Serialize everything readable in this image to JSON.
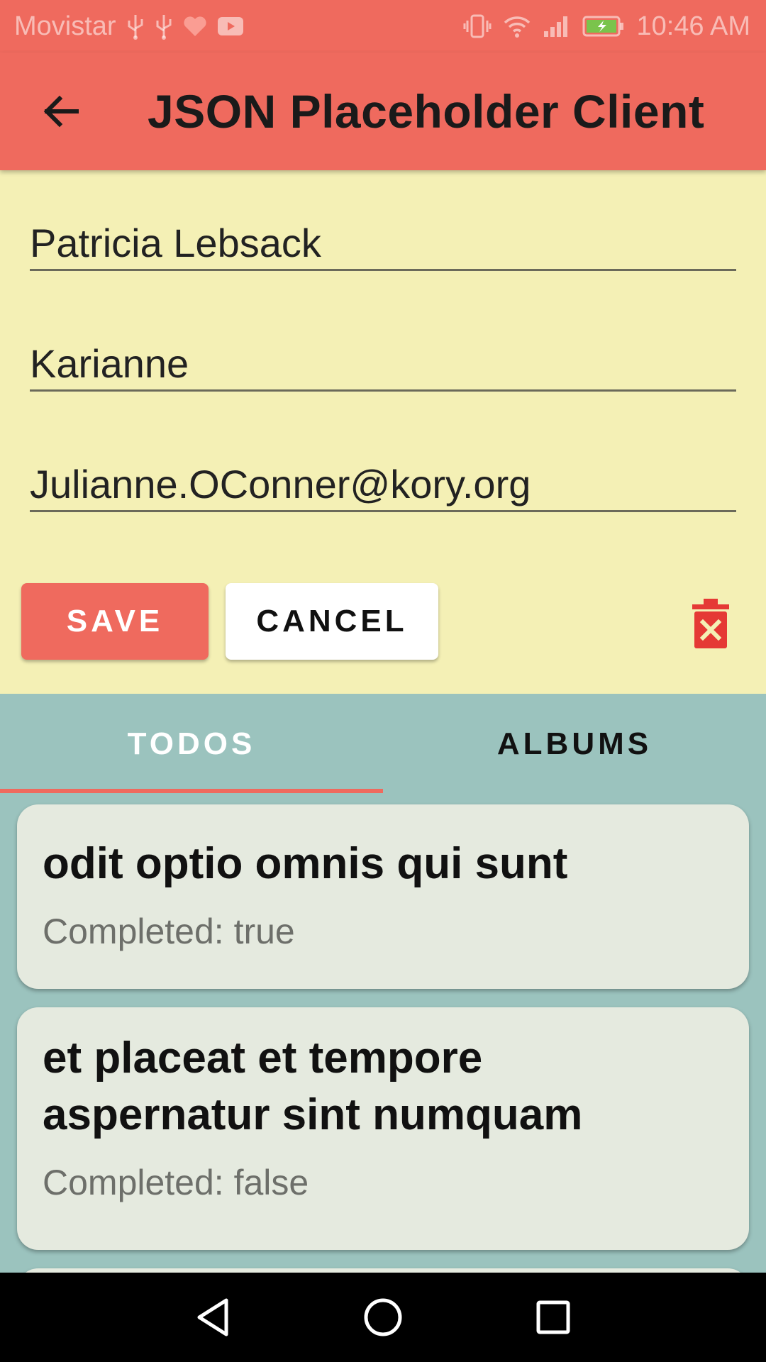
{
  "status_bar": {
    "carrier": "Movistar",
    "time": "10:46 AM",
    "icons": [
      "usb-icon",
      "usb-icon",
      "health-icon",
      "youtube-icon",
      "vibrate-icon",
      "wifi-icon",
      "signal-icon",
      "battery-charging-icon"
    ]
  },
  "app_bar": {
    "title": "JSON Placeholder Client",
    "back_icon": "arrow-back-icon"
  },
  "form": {
    "name": "Patricia Lebsack",
    "username": "Karianne",
    "email": "Julianne.OConner@kory.org",
    "save_label": "SAVE",
    "cancel_label": "CANCEL",
    "delete_icon": "trash-delete-icon"
  },
  "tabs": [
    {
      "label": "TODOS",
      "active": true
    },
    {
      "label": "ALBUMS",
      "active": false
    }
  ],
  "todos": [
    {
      "title": "odit optio omnis qui sunt",
      "status": "Completed: true"
    },
    {
      "title": "et placeat et tempore aspernatur sint numquam",
      "status": "Completed: false"
    }
  ],
  "colors": {
    "primary": "#ef6a5e",
    "form_bg": "#f4f0b5",
    "list_bg": "#9bc3be",
    "card_bg": "#e5eadf",
    "delete_red": "#e53935"
  },
  "nav_bar": {
    "icons": [
      "nav-back-icon",
      "nav-home-icon",
      "nav-recents-icon"
    ]
  }
}
